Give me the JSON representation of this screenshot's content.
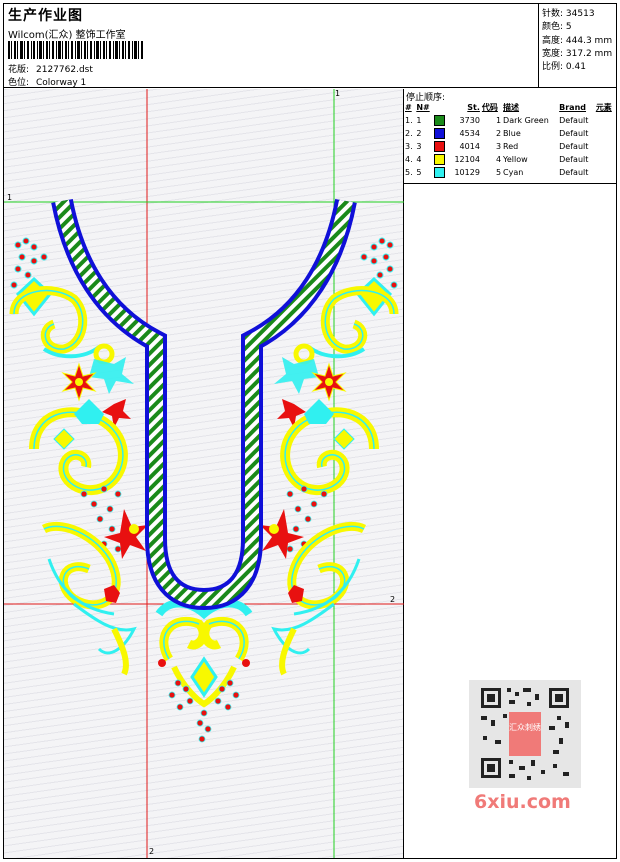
{
  "header": {
    "title": "生产作业图",
    "company": "Wilcom(汇众) 整饰工作室",
    "design_label": "花版:",
    "design_value": "2127762.dst",
    "colorway_label": "色位:",
    "colorway_value": "Colorway 1"
  },
  "stats": [
    {
      "label": "针数",
      "value": "34513"
    },
    {
      "label": "颜色",
      "value": "5"
    },
    {
      "label": "高度",
      "value": "444.3 mm"
    },
    {
      "label": "宽度",
      "value": "317.2 mm"
    },
    {
      "label": "比例",
      "value": "0.41"
    }
  ],
  "stop_sequence": {
    "title": "停止顺序:",
    "columns": [
      "#",
      "N#",
      "St.",
      "代码",
      "描述",
      "Brand",
      "元素"
    ],
    "rows": [
      {
        "idx": "1.",
        "n": "1",
        "color": "#1a8a1a",
        "st": "3730",
        "code": "1",
        "desc": "Dark Green",
        "brand": "Default"
      },
      {
        "idx": "2.",
        "n": "2",
        "color": "#1010d8",
        "st": "4534",
        "code": "2",
        "desc": "Blue",
        "brand": "Default"
      },
      {
        "idx": "3.",
        "n": "3",
        "color": "#e81010",
        "st": "4014",
        "code": "3",
        "desc": "Red",
        "brand": "Default"
      },
      {
        "idx": "4.",
        "n": "4",
        "color": "#f8f800",
        "st": "12104",
        "code": "4",
        "desc": "Yellow",
        "brand": "Default"
      },
      {
        "idx": "5.",
        "n": "5",
        "color": "#30f0f0",
        "st": "10129",
        "code": "5",
        "desc": "Cyan",
        "brand": "Default"
      }
    ]
  },
  "markers": {
    "v1": "1",
    "h1": "1",
    "h2": "2",
    "v2": "2"
  },
  "watermark": {
    "text": "6xiu.com",
    "qr_badge": "汇众刺绣"
  },
  "colors": {
    "green": "#1a8a1a",
    "blue": "#1010d8",
    "red": "#e81010",
    "yellow": "#f8f800",
    "cyan": "#30f0f0",
    "guide_red": "#e01818",
    "guide_green": "#20d020"
  }
}
